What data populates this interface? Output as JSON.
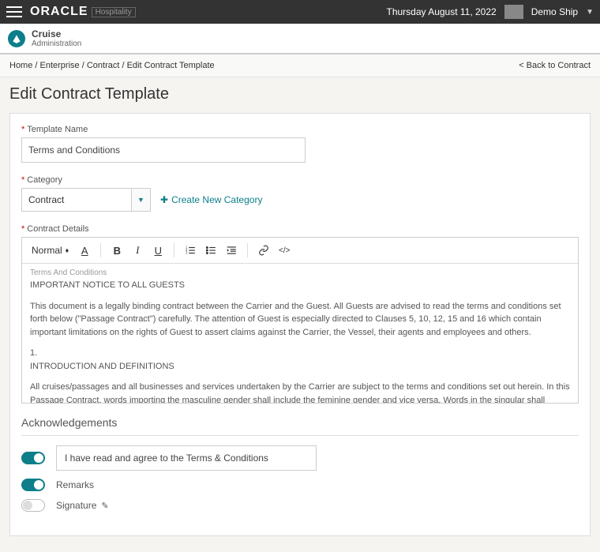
{
  "topbar": {
    "brand": "ORACLE",
    "brand_sub": "Hospitality",
    "date": "Thursday August 11, 2022",
    "ship": "Demo Ship"
  },
  "subheader": {
    "title": "Cruise",
    "subtitle": "Administration"
  },
  "breadcrumb": {
    "home": "Home",
    "enterprise": "Enterprise",
    "contract": "Contract",
    "current": "Edit Contract Template",
    "back": "< Back to Contract"
  },
  "page": {
    "title": "Edit Contract Template"
  },
  "form": {
    "template_name_label": "Template Name",
    "template_name_value": "Terms and Conditions",
    "category_label": "Category",
    "category_value": "Contract",
    "create_category": "Create New Category",
    "details_label": "Contract Details"
  },
  "editor": {
    "format": "Normal",
    "body": {
      "line1": "Terms And Conditions",
      "line2": "IMPORTANT NOTICE TO ALL GUESTS",
      "para1": "This document is a legally binding contract between the Carrier and the Guest. All Guests are advised to read the terms and conditions set forth below (\"Passage Contract\") carefully. The attention of Guest is especially directed to Clauses 5, 10, 12, 15 and 16 which contain important limitations on the rights of Guest to assert claims against the Carrier, the Vessel, their agents and employees and others.",
      "num": "1.",
      "heading": "INTRODUCTION AND DEFINITIONS",
      "para2": "All cruises/passages and all businesses and services undertaken by the Carrier are subject to the terms and conditions set out herein. In this Passage Contract, words importing the masculine gender shall include the feminine gender and vice versa. Words in the singular shall include the plural and words in the plural shall include the singular."
    }
  },
  "ack": {
    "title": "Acknowledgements",
    "terms_text": "I have read and agree to the Terms & Conditions",
    "remarks": "Remarks",
    "signature": "Signature"
  }
}
